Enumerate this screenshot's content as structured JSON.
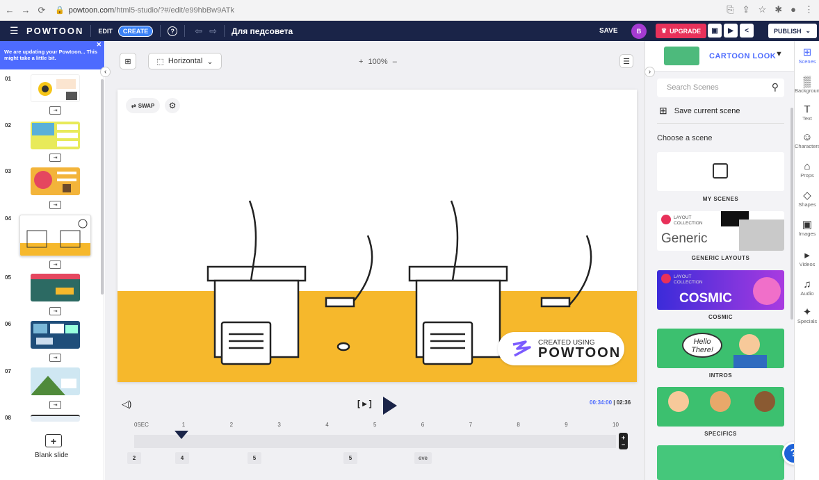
{
  "browser": {
    "url_host": "powtoon.com",
    "url_path": "/html5-studio/?#/edit/e99hbBw9ATk"
  },
  "topbar": {
    "logo": "POWTOON",
    "edit": "EDIT",
    "create": "CREATE",
    "title": "Для педсовета",
    "save": "SAVE",
    "avatar": "B",
    "upgrade": "UPGRADE",
    "publish": "PUBLISH"
  },
  "left": {
    "notice": "We are updating your Powtoon... This might take a little bit.",
    "slides": [
      {
        "num": "01"
      },
      {
        "num": "02"
      },
      {
        "num": "03"
      },
      {
        "num": "04"
      },
      {
        "num": "05"
      },
      {
        "num": "06"
      },
      {
        "num": "07"
      },
      {
        "num": "08"
      }
    ],
    "blank_label": "Blank slide"
  },
  "canvas": {
    "orientation": "Horizontal",
    "zoom": "100%",
    "swap": "SWAP",
    "badge_line1": "CREATED USING",
    "badge_line2": "POWTOON"
  },
  "timeline": {
    "current": "00:34:00",
    "total": "02:36",
    "ticks": [
      "0SEC",
      "1",
      "2",
      "3",
      "4",
      "5",
      "6",
      "7",
      "8",
      "9",
      "10"
    ],
    "durations": [
      "2",
      "4",
      "5",
      "5",
      "eve"
    ]
  },
  "library": {
    "look": "CARTOON LOOK",
    "search_placeholder": "Search Scenes",
    "save_scene": "Save current scene",
    "choose": "Choose a scene",
    "cards": [
      {
        "label": "MY SCENES"
      },
      {
        "label": "GENERIC LAYOUTS",
        "tag": "LAYOUT COLLECTION",
        "title": "Generic"
      },
      {
        "label": "COSMIC",
        "tag": "LAYOUT COLLECTION",
        "title": "COSMIC"
      },
      {
        "label": "INTROS",
        "bubble": "Hello There!"
      },
      {
        "label": "SPECIFICS"
      }
    ]
  },
  "rail": [
    {
      "label": "Scenes"
    },
    {
      "label": "Backgrounds"
    },
    {
      "label": "Text"
    },
    {
      "label": "Characters"
    },
    {
      "label": "Props"
    },
    {
      "label": "Shapes"
    },
    {
      "label": "Images"
    },
    {
      "label": "Videos"
    },
    {
      "label": "Audio"
    },
    {
      "label": "Specials"
    }
  ],
  "colors": {
    "brand_navy": "#1a2448",
    "accent_blue": "#4d6bfe",
    "upgrade_pink": "#e8315a",
    "floor_yellow": "#f6b82c"
  }
}
